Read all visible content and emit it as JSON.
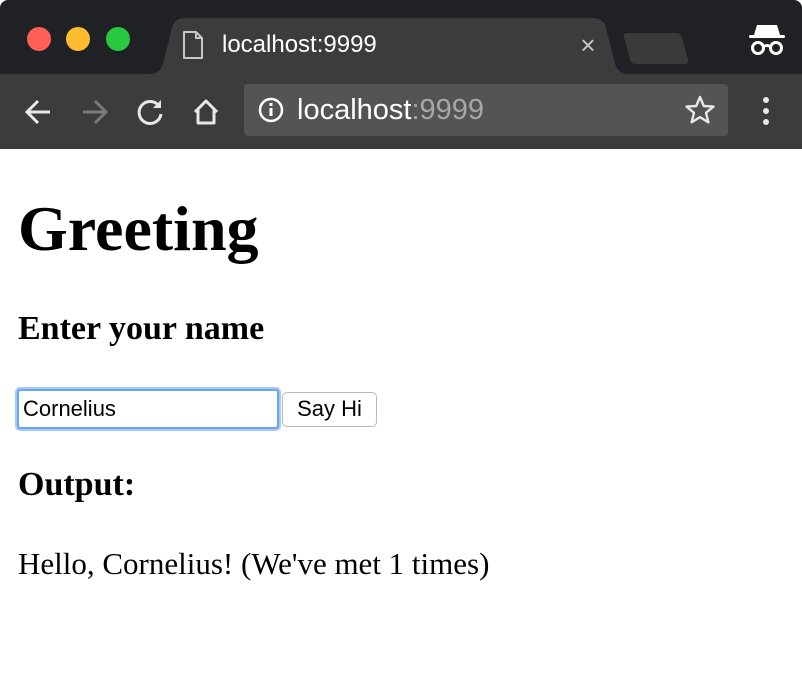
{
  "browser": {
    "tab": {
      "title": "localhost:9999",
      "close_glyph": "×",
      "icon": "document-icon"
    },
    "address_bar": {
      "host": "localhost",
      "port": ":9999",
      "icon": "info-icon"
    },
    "buttons": [
      "back",
      "forward",
      "reload",
      "home",
      "bookmark-star",
      "menu"
    ],
    "incognito": true,
    "colors": {
      "titlebar": "#202124",
      "toolbar": "#3c3c3c",
      "omnibox": "#545454",
      "close_red": "#ff5f57",
      "minimize_yellow": "#febc2e",
      "zoom_green": "#28c840"
    }
  },
  "page": {
    "heading": "Greeting",
    "prompt": "Enter your name",
    "name_value": "Cornelius",
    "button_label": "Say Hi",
    "output_heading": "Output:",
    "output_text": "Hello, Cornelius! (We've met 1 times)"
  }
}
